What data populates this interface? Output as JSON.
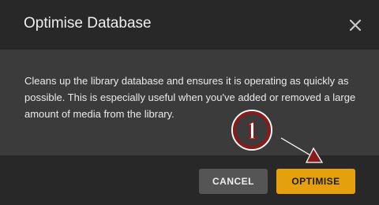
{
  "dialog": {
    "title": "Optimise Database",
    "close_icon": "close-icon",
    "description": "Cleans up the library database and ensures it is operating as quickly as possible. This is especially useful when you've added or removed a large amount of media from the library.",
    "buttons": {
      "cancel_label": "CANCEL",
      "optimise_label": "OPTIMISE"
    }
  },
  "annotation": {
    "step_number": "1",
    "marker_color": "#8b1a1a"
  },
  "colors": {
    "header_bg": "#282828",
    "body_bg": "#3b3b3b",
    "accent": "#e5a00d",
    "cancel_bg": "#555555"
  }
}
